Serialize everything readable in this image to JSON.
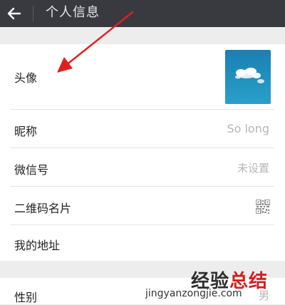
{
  "header": {
    "title": "个人信息",
    "back_icon": "back-arrow-icon"
  },
  "rows": [
    {
      "label": "头像",
      "type": "avatar"
    },
    {
      "label": "昵称",
      "value": "So long"
    },
    {
      "label": "微信号",
      "value": "未设置"
    },
    {
      "label": "二维码名片",
      "icon": "qr-code-icon"
    },
    {
      "label": "我的地址"
    }
  ],
  "section2": [
    {
      "label": "性别",
      "value": "男"
    }
  ],
  "annotation": {
    "color": "#e02020",
    "type": "red-arrow"
  },
  "watermark": {
    "part1": "经验",
    "part2": "总结",
    "domain": "jingyanzongjie.com"
  },
  "colors": {
    "header_bg": "#393a3f",
    "page_bg": "#ededed",
    "value_text": "#b5b5b5"
  }
}
